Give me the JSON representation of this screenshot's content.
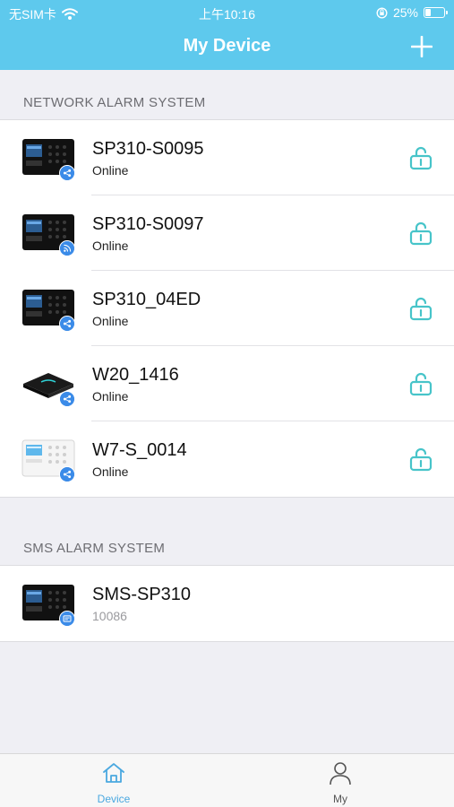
{
  "status_bar": {
    "carrier": "无SIM卡",
    "time": "上午10:16",
    "battery": "25%"
  },
  "nav": {
    "title": "My Device",
    "add_icon": "plus-icon"
  },
  "network_section": {
    "header": "NETWORK ALARM SYSTEM",
    "devices": [
      {
        "name": "SP310-S0095",
        "status": "Online",
        "badge_icon": "share-icon",
        "action_icon": "unlocked-icon"
      },
      {
        "name": "SP310-S0097",
        "status": "Online",
        "badge_icon": "wifi-icon",
        "action_icon": "unlocked-icon"
      },
      {
        "name": "SP310_04ED",
        "status": "Online",
        "badge_icon": "share-icon",
        "action_icon": "unlocked-icon"
      },
      {
        "name": "W20_1416",
        "status": "Online",
        "badge_icon": "share-icon",
        "action_icon": "unlocked-icon"
      },
      {
        "name": "W7-S_0014",
        "status": "Online",
        "badge_icon": "share-icon",
        "action_icon": "unlocked-icon"
      }
    ]
  },
  "sms_section": {
    "header": "SMS ALARM SYSTEM",
    "devices": [
      {
        "name": "SMS-SP310",
        "status": "10086",
        "badge_icon": "sms-icon"
      }
    ]
  },
  "tabs": [
    {
      "label": "Device",
      "icon": "home-icon",
      "active": true
    },
    {
      "label": "My",
      "icon": "user-icon",
      "active": false
    }
  ],
  "colors": {
    "primary": "#5ec9ed",
    "accent_active": "#4aa8e0",
    "lock_icon": "#47c4c9",
    "badge": "#3b8be8",
    "background": "#efeff4"
  }
}
